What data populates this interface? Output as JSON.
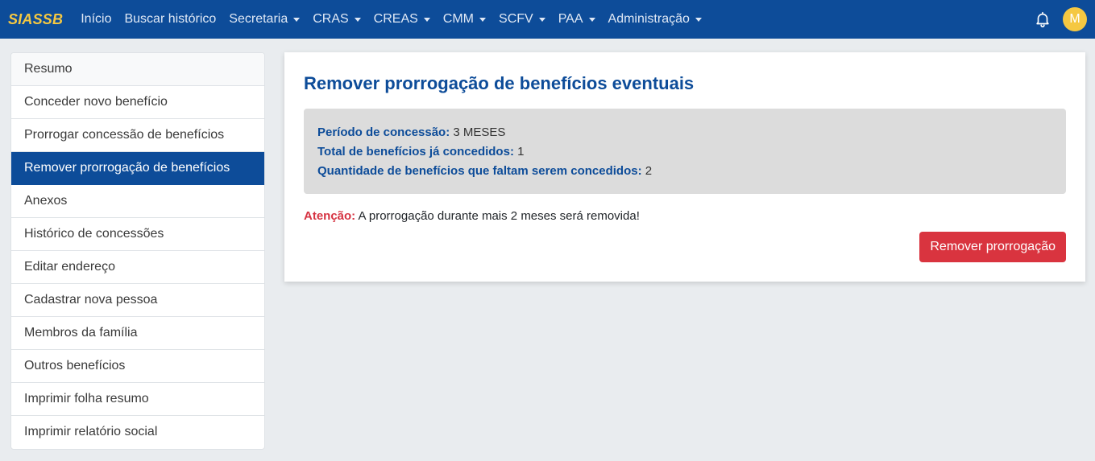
{
  "navbar": {
    "brand": "SIASSB",
    "items": [
      {
        "label": "Início",
        "dropdown": false
      },
      {
        "label": "Buscar histórico",
        "dropdown": false
      },
      {
        "label": "Secretaria",
        "dropdown": true
      },
      {
        "label": "CRAS",
        "dropdown": true
      },
      {
        "label": "CREAS",
        "dropdown": true
      },
      {
        "label": "CMM",
        "dropdown": true
      },
      {
        "label": "SCFV",
        "dropdown": true
      },
      {
        "label": "PAA",
        "dropdown": true
      },
      {
        "label": "Administração",
        "dropdown": true
      }
    ],
    "avatar_initial": "M",
    "icons": {
      "notifications": "bell-icon"
    }
  },
  "sidebar": {
    "items": [
      {
        "label": "Resumo"
      },
      {
        "label": "Conceder novo benefício"
      },
      {
        "label": "Prorrogar concessão de benefícios"
      },
      {
        "label": "Remover prorrogação de benefícios"
      },
      {
        "label": "Anexos"
      },
      {
        "label": "Histórico de concessões"
      },
      {
        "label": "Editar endereço"
      },
      {
        "label": "Cadastrar nova pessoa"
      },
      {
        "label": "Membros da família"
      },
      {
        "label": "Outros benefícios"
      },
      {
        "label": "Imprimir folha resumo"
      },
      {
        "label": "Imprimir relatório social"
      }
    ],
    "active_index": 3
  },
  "main": {
    "title": "Remover prorrogação de benefícios eventuais",
    "info": {
      "periodo_label": "Período de concessão:",
      "periodo_value": "3 MESES",
      "total_label": "Total de benefícios já concedidos:",
      "total_value": "1",
      "faltam_label": "Quantidade de benefícios que faltam serem concedidos:",
      "faltam_value": "2"
    },
    "warning": {
      "label": "Atenção:",
      "text": "A prorrogação durante mais 2 meses será removida!"
    },
    "remove_button": "Remover prorrogação"
  },
  "colors": {
    "primary": "#0d4c99",
    "brand": "#f5c842",
    "danger": "#d9343f",
    "background": "#e9ecef"
  }
}
